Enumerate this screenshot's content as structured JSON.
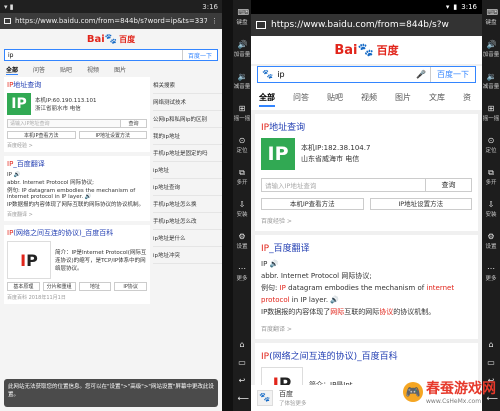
{
  "left_phone": {
    "status_time": "3:16",
    "url": "https://www.baidu.com/from=844b/s?word=ip&ts=337",
    "logo_bai": "Bai",
    "logo_paw": "🐾",
    "logo_baidu": "百度",
    "search_value": "ip",
    "search_button": "百度一下",
    "tabs": [
      "全部",
      "问答",
      "贴吧",
      "视频",
      "图片"
    ],
    "ip_card": {
      "title_em": "IP",
      "title_rest": "地址查询",
      "ip_line": "本机IP:60.190.113.101",
      "loc_line": "浙江省丽水市 电信",
      "input_placeholder": "请输入IP地址查询",
      "query_btn": "查询",
      "btn1": "本机IP查看方法",
      "btn2": "IP地址设置方法",
      "source": "百度经验 >"
    },
    "fanyi_card": {
      "title_em": "IP",
      "title_rest": "_百度翻译",
      "line1": "IP 🔊",
      "line2": "abbr. Internet Protocol 网际协议;",
      "line3": "例句: IP datagram embodies the mechanism of internet protocol in IP layer. 🔊",
      "line4": "IP数据报的内容体现了网际互联的网际协议的协议机制。",
      "source": "百度翻译 >"
    },
    "baike_card": {
      "title_em": "IP",
      "title_rest": "(网络之间互连的协议)_百度百科",
      "line1": "简介：IP是Internet Protocol(网际互连协议)的缩写，是TCP/IP体系中的网络层协议。",
      "btns": [
        "基本原理",
        "分片和重组",
        "地址",
        "IP协议"
      ],
      "date": "百度百科 2018年11月1日"
    },
    "side": [
      "相关搜索",
      "网络测试技术",
      "公网ip和私网ip的区别",
      "我的ip地址",
      "手机ip地址是固定的吗",
      "ip地址",
      "ip地址查询",
      "手机ip地址怎么换",
      "手机ip地址怎么改",
      "ip地址是什么",
      "ip地址冲突"
    ],
    "toast": "此网站无法获取您的位置信息。您可以在\"设置\">\"高级\">\"网站设置\"屏幕中更改此设置。"
  },
  "emulator": {
    "left_tools": [
      {
        "icon": "⌨",
        "label": "键盘"
      },
      {
        "icon": "🔊",
        "label": "加音量"
      },
      {
        "icon": "🔉",
        "label": "减音量"
      },
      {
        "icon": "⊞",
        "label": "摇一摇"
      },
      {
        "icon": "⊙",
        "label": "定位"
      },
      {
        "icon": "⧉",
        "label": "多开"
      },
      {
        "icon": "⇩",
        "label": "安装"
      },
      {
        "icon": "⚙",
        "label": "设置"
      },
      {
        "icon": "⋯",
        "label": "更多"
      }
    ],
    "left_nav": [
      "⌂",
      "▭",
      "↩",
      "⟵"
    ],
    "right_tools": [
      {
        "icon": "⌨",
        "label": "键盘"
      },
      {
        "icon": "🔊",
        "label": "加音量"
      },
      {
        "icon": "🔉",
        "label": "减音量"
      },
      {
        "icon": "⊞",
        "label": "摇一摇"
      },
      {
        "icon": "⊙",
        "label": "定位"
      },
      {
        "icon": "⧉",
        "label": "多开"
      },
      {
        "icon": "⇩",
        "label": "安装"
      },
      {
        "icon": "⚙",
        "label": "设置"
      },
      {
        "icon": "⋯",
        "label": "更多"
      }
    ],
    "right_nav": [
      "⌂",
      "▭",
      "↩",
      "⟵"
    ]
  },
  "screen": {
    "status_time": "3:16",
    "url": "https://www.baidu.com/from=844b/s?w",
    "logo_bai": "Bai",
    "logo_paw": "🐾",
    "logo_baidu": "百度",
    "search_paw": "🐾",
    "search_value": "ip",
    "search_mic": "🎤",
    "search_button": "百度一下",
    "tabs": [
      "全部",
      "问答",
      "贴吧",
      "视频",
      "图片",
      "文库",
      "资"
    ],
    "ip_card": {
      "title_em": "IP",
      "title_rest": "地址查询",
      "ip_line": "本机IP:182.38.104.7",
      "loc_line": "山东省威海市 电信",
      "input_placeholder": "请输入IP地址查询",
      "query_btn": "查询",
      "btn1": "本机IP查看方法",
      "btn2": "IP地址设置方法",
      "source": "百度经验 >"
    },
    "fanyi_card": {
      "title_em": "IP",
      "title_rest": "_百度翻译",
      "l1": "IP 🔊",
      "l2": "abbr. Internet Protocol 网际协议;",
      "l3a": "例句: ",
      "l3b": "IP",
      "l3c": " datagram embodies the mechanism of ",
      "l3d": "internet protocol",
      "l3e": " in IP layer. 🔊",
      "l4a": "IP数据报的内容体现了",
      "l4b": "网际",
      "l4c": "互联的网际",
      "l4d": "协议",
      "l4e": "的协议机制。",
      "source": "百度翻译 >"
    },
    "baike_card": {
      "title_em": "IP",
      "title_rest": "(网络之间互连的协议)_百度百科",
      "intro": "简介：IP是Int"
    },
    "bottom": {
      "paw": "🐾",
      "title": "百度",
      "sub": "了体验更多"
    }
  },
  "watermark": {
    "icon": "🎮",
    "text": "春蚕游戏网",
    "sub": "www.CsHeMx.com"
  }
}
